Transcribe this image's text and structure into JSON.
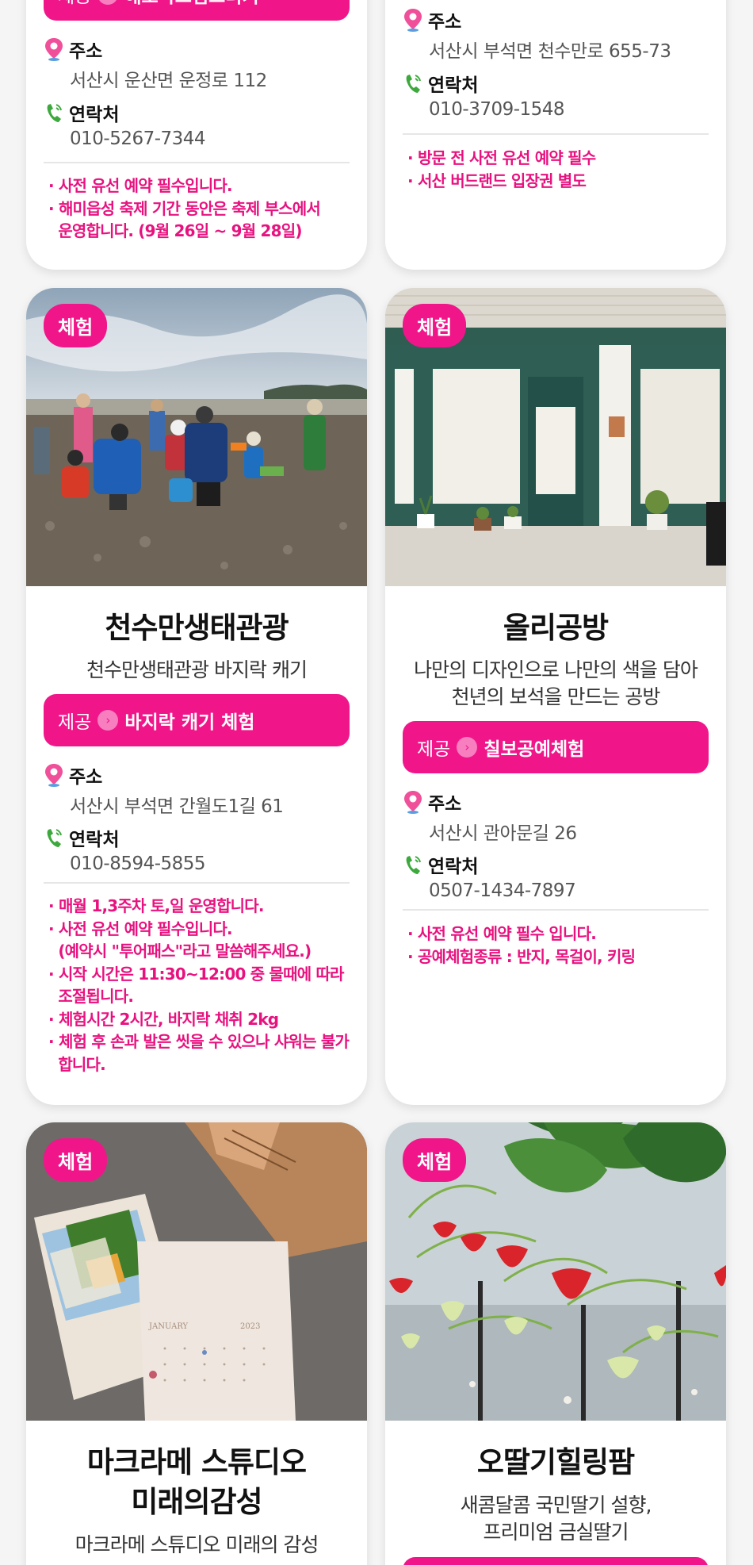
{
  "labels": {
    "address": "주소",
    "contact": "연락처",
    "provide": "제공"
  },
  "cards": [
    {
      "badge": "",
      "title": "",
      "subtitle": [],
      "provide": "",
      "address": "서산시 운산면 운정로 112",
      "phone": "010-5267-7344",
      "notes": [
        "· 사전 유선 예약 필수입니다.",
        "· 해미읍성 축제 기간 동안은 축제 부스에서",
        "  운영합니다. (9월 26일 ~ 9월 28일)"
      ]
    },
    {
      "badge": "",
      "title": "",
      "subtitle": [],
      "provide": "",
      "address": "서산시 부석면 천수만로 655-73",
      "phone": "010-3709-1548",
      "notes": [
        "· 방문 전 사전 유선 예약 필수",
        "· 서산 버드랜드 입장권 별도"
      ]
    },
    {
      "badge": "체험",
      "title": "천수만생태관광",
      "subtitle": [
        "천수만생태관광 바지락 캐기"
      ],
      "provide": "바지락 캐기 체험",
      "address": "서산시 부석면 간월도1길 61",
      "phone": "010-8594-5855",
      "notes": [
        "· 매월 1,3주차 토,일 운영합니다.",
        "· 사전 유선 예약 필수입니다.",
        "  (예약시 \"투어패스\"라고 말씀해주세요.)",
        "· 시작 시간은 11:30~12:00 중 물때에 따라",
        "  조절됩니다.",
        "· 체험시간 2시간, 바지락 채취 2kg",
        "· 체험 후 손과 발은 씻을 수 있으나 샤워는 불가",
        "  합니다."
      ]
    },
    {
      "badge": "체험",
      "title": "올리공방",
      "subtitle": [
        "나만의 디자인으로 나만의 색을 담아",
        "천년의 보석을 만드는 공방"
      ],
      "provide": "칠보공예체험",
      "address": "서산시 관아문길 26",
      "phone": "0507-1434-7897",
      "notes": [
        "· 사전 유선 예약 필수 입니다.",
        "· 공예체험종류 : 반지, 목걸이, 키링"
      ]
    },
    {
      "badge": "체험",
      "title": [
        "마크라메 스튜디오",
        "미래의감성"
      ],
      "subtitle": [
        "마크라메 스튜디오 미래의 감성"
      ]
    },
    {
      "badge": "체험",
      "title": [
        "오딸기힐링팜"
      ],
      "subtitle": [
        "새콤달콤 국민딸기 설향,",
        "프리미엄 금실딸기"
      ]
    }
  ],
  "colors": {
    "accent": "#f0168a",
    "note": "#e8127f",
    "page_bg": "#f5f5f5"
  },
  "icons": {
    "address": "map-pin-icon",
    "contact": "phone-icon",
    "arrow": "chevron-right-icon"
  }
}
